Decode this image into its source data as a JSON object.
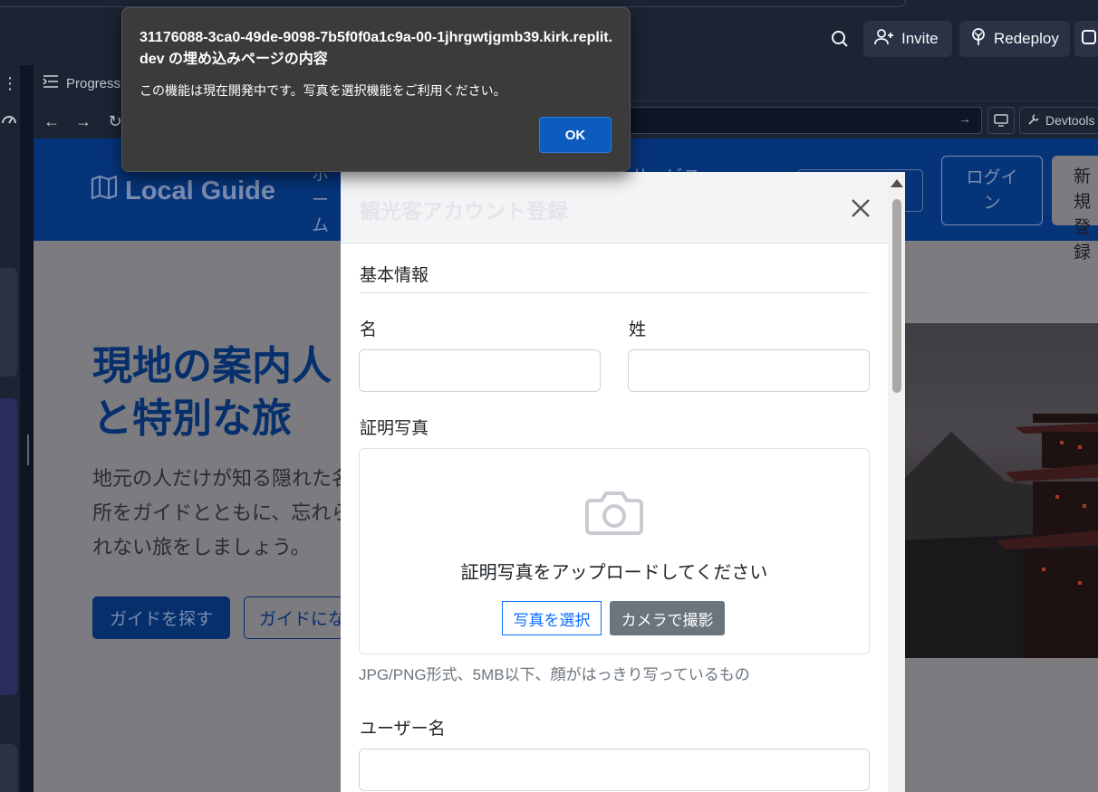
{
  "replit": {
    "invite_label": "Invite",
    "redeploy_label": "Redeploy",
    "tab_progress": "Progress",
    "devtools_label": "Devtools"
  },
  "site": {
    "brand": "Local Guide",
    "nav_home": "ホーム",
    "nav_partial": "サービス",
    "login": "ログイン",
    "signup": "新規登録",
    "hero_title": "現地の案内人と特別な旅",
    "hero_sub": "地元の人だけが知る隠れた名所をガイドとともに、忘れられない旅をしましょう。",
    "btn_find": "ガイドを探す",
    "btn_become": "ガイドになる"
  },
  "modal": {
    "title": "観光客アカウント登録",
    "section_basic": "基本情報",
    "label_first": "名",
    "label_last": "姓",
    "label_photo": "証明写真",
    "upload_prompt": "証明写真をアップロードしてください",
    "btn_select": "写真を選択",
    "btn_camera": "カメラで撮影",
    "photo_help": "JPG/PNG形式、5MB以下、顔がはっきり写っているもの",
    "label_username": "ユーザー名",
    "first_value": "",
    "last_value": "",
    "username_value": ""
  },
  "alert": {
    "title": "31176088-3ca0-49de-9098-7b5f0f0a1c9a-00-1jhrgwtjgmb39.kirk.replit.dev の埋め込みページの内容",
    "message": "この機能は現在開発中です。写真を選択機能をご利用ください。",
    "ok": "OK"
  },
  "colors": {
    "replit_bg": "#1c2333",
    "header_blue": "#063479",
    "primary": "#0d6efd",
    "secondary": "#6c757d",
    "alert_bg": "#3b3b3b",
    "alert_ok": "#0b5cbd"
  }
}
